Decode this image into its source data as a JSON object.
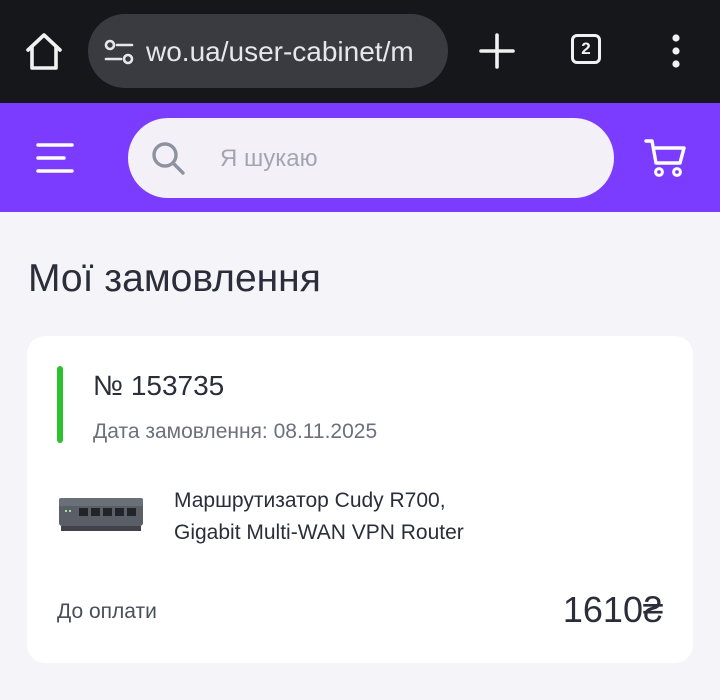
{
  "browser": {
    "url": "wo.ua/user-cabinet/m",
    "tab_count": "2",
    "icons": [
      "home-icon",
      "site-settings-icon",
      "plus-icon",
      "tabs-icon",
      "more-vert-icon"
    ]
  },
  "header": {
    "search_placeholder": "Я шукаю",
    "icons": [
      "hamburger-icon",
      "search-icon",
      "cart-icon"
    ],
    "background_color": "#7b3cff"
  },
  "page": {
    "title": "Мої замовлення"
  },
  "order": {
    "number": "№ 153735",
    "date": "Дата замовлення: 08.11.2025",
    "status_color": "#2dc12e",
    "product": {
      "name_line1": "Маршрутизатор Cudy R700,",
      "name_line2": "Gigabit Multi-WAN VPN Router"
    },
    "payment_label": "До оплати",
    "payment_amount": "1610₴"
  }
}
